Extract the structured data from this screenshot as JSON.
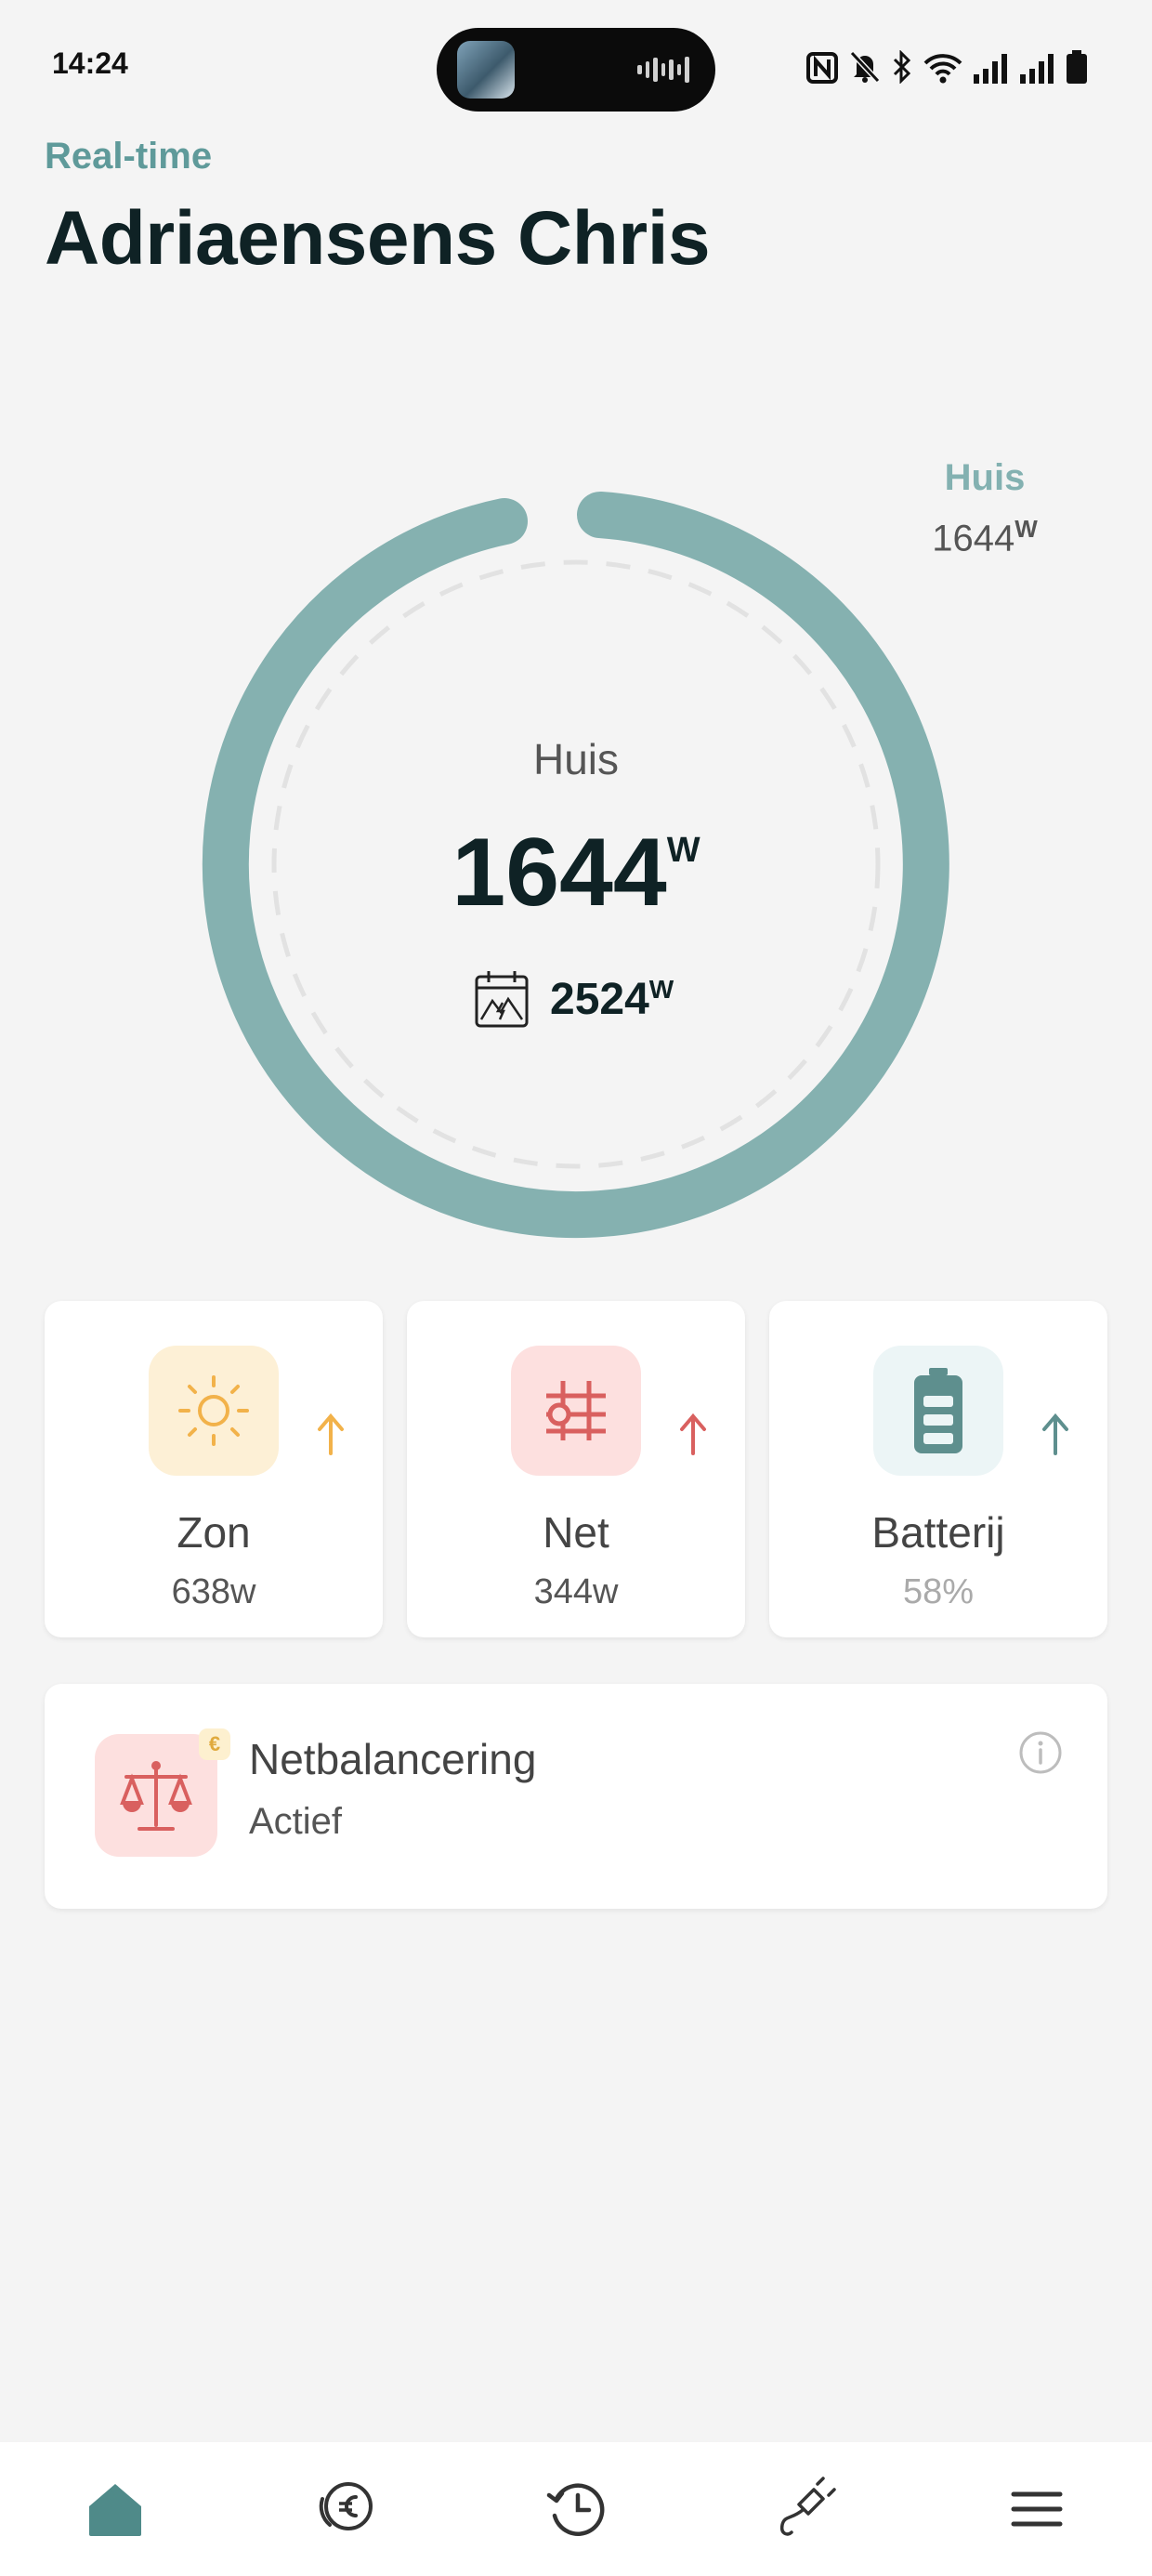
{
  "status_bar": {
    "time": "14:24",
    "icons": [
      "nfc-icon",
      "bell-muted-icon",
      "bluetooth-icon",
      "wifi-icon",
      "signal-icon",
      "signal-icon",
      "battery-icon"
    ]
  },
  "header": {
    "subtitle": "Real-time",
    "title": "Adriaensens Chris"
  },
  "gauge": {
    "corner_label": "Huis",
    "corner_value": "1644",
    "corner_unit": "W",
    "center_label": "Huis",
    "center_value": "1644",
    "center_unit": "W",
    "peak_value": "2524",
    "peak_unit": "W",
    "peak_icon": "calendar-peak-icon",
    "ring_color": "#85b1b0"
  },
  "cards": [
    {
      "label": "Zon",
      "value": "638w",
      "icon": "sun-icon",
      "color": "#f2b24a",
      "bg": "#fdf0d6",
      "arrow": "up"
    },
    {
      "label": "Net",
      "value": "344w",
      "icon": "grid-icon",
      "color": "#d9605f",
      "bg": "#fde0df",
      "arrow": "up"
    },
    {
      "label": "Batterij",
      "value": "58%",
      "icon": "battery-icon",
      "color": "#5e8f8e",
      "bg": "#ecf5f6",
      "arrow": "up"
    }
  ],
  "netbalancing": {
    "title": "Netbalancering",
    "status": "Actief",
    "icon": "scale-icon",
    "badge": "€"
  },
  "bottom_nav": [
    {
      "icon": "home-icon",
      "active": true
    },
    {
      "icon": "euro-icon",
      "active": false
    },
    {
      "icon": "history-icon",
      "active": false
    },
    {
      "icon": "plug-icon",
      "active": false
    },
    {
      "icon": "menu-icon",
      "active": false
    }
  ],
  "colors": {
    "accent": "#5f9a9a",
    "nav_active": "#4f8a89",
    "text_dark": "#0f2225"
  }
}
